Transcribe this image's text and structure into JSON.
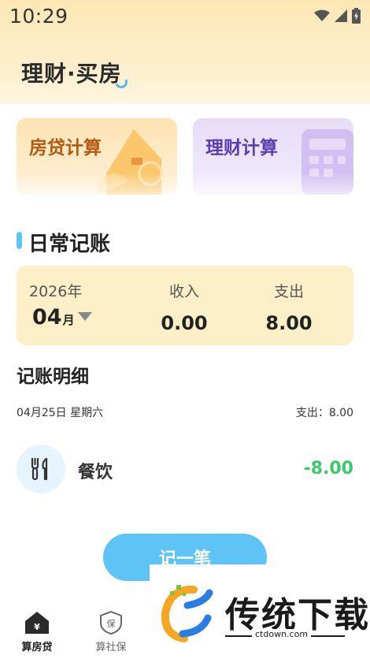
{
  "status_bar": {
    "time": "10:29"
  },
  "header": {
    "title": "理财·买房"
  },
  "cards": {
    "mortgage": {
      "label": "房贷计算"
    },
    "finance": {
      "label": "理财计算"
    }
  },
  "daily": {
    "section_title": "日常记账",
    "year": "2026年",
    "month": "04",
    "month_suffix": "月",
    "income_label": "收入",
    "income_value": "0.00",
    "expense_label": "支出",
    "expense_value": "8.00"
  },
  "details": {
    "title": "记账明细",
    "date": "04月25日 星期六",
    "day_expense": "支出：8.00",
    "records": [
      {
        "icon": "fork-knife-icon",
        "category": "餐饮",
        "amount": "-8.00"
      }
    ]
  },
  "add_button": {
    "label": "记一笔"
  },
  "nav": {
    "items": [
      {
        "icon": "house-yen-icon",
        "label": "算房贷",
        "active": true
      },
      {
        "icon": "shield-bao-icon",
        "label": "算社保",
        "active": false
      }
    ]
  },
  "watermark": {
    "text": "传统下载",
    "url": "ctdown.com"
  },
  "colors": {
    "accent_blue": "#5ec3f5",
    "header_yellow": "#fde7b4",
    "income_green": "#3cc86e",
    "mortgage_text": "#b45a10",
    "finance_text": "#5a3fb0"
  }
}
